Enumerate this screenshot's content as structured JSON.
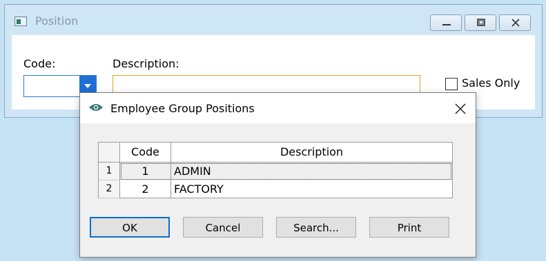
{
  "parent_window": {
    "title": "Position",
    "code_label": "Code:",
    "code_value": "",
    "description_label": "Description:",
    "description_value": "",
    "sales_only_label": "Sales Only",
    "sales_only_checked": false
  },
  "dialog": {
    "title": "Employee Group Positions",
    "table": {
      "columns": [
        "",
        "Code",
        "Description"
      ],
      "rows": [
        {
          "row_num": "1",
          "code": "1",
          "description": "ADMIN"
        },
        {
          "row_num": "2",
          "code": "2",
          "description": "FACTORY"
        }
      ]
    },
    "buttons": {
      "ok": "OK",
      "cancel": "Cancel",
      "search": "Search...",
      "print": "Print"
    }
  },
  "colors": {
    "desktop_bg": "#c5e3f5",
    "focus_blue": "#1e6fd4",
    "input_focus_orange": "#e0a21e"
  }
}
